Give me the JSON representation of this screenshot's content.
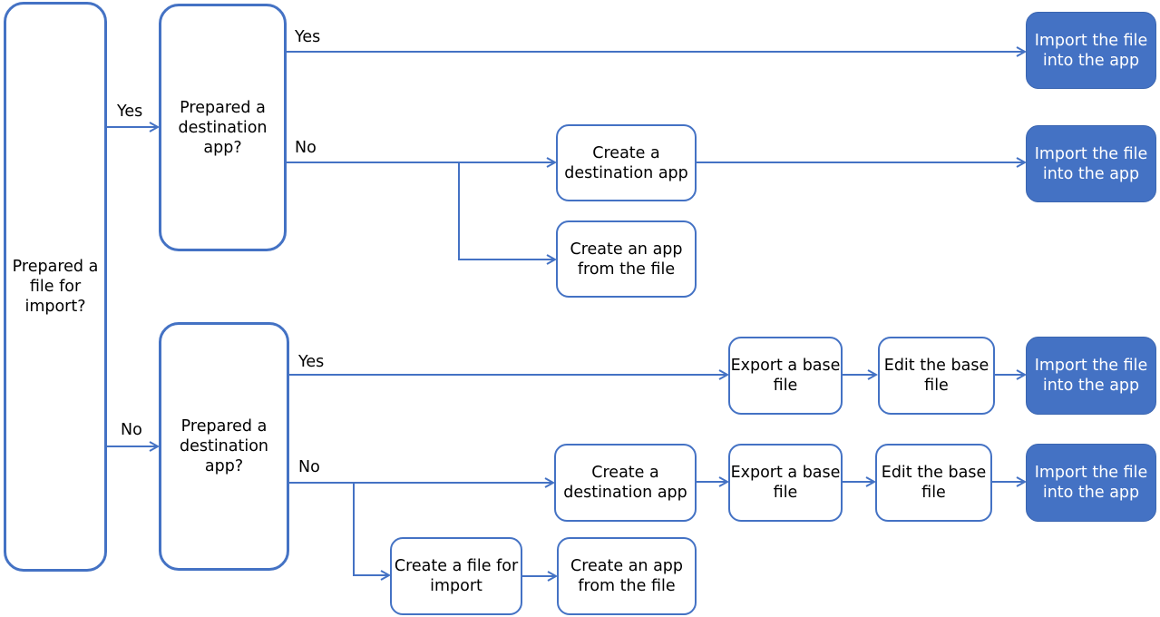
{
  "colors": {
    "accent": "#4472C4",
    "text": "#000000",
    "filled_text": "#FFFFFF"
  },
  "nodes": {
    "root": "Prepared a file for import?",
    "q_top": "Prepared a destination app?",
    "q_bottom": "Prepared a destination app?",
    "create_dest_top": "Create a destination app",
    "create_app_file_top": "Create an app from the file",
    "import_1": "Import the file into the app",
    "import_2": "Import the file into the app",
    "export_1": "Export a base file",
    "edit_1": "Edit the base file",
    "import_3": "Import the file into the app",
    "create_dest_bottom": "Create a destination app",
    "export_2": "Export a base file",
    "edit_2": "Edit the base file",
    "import_4": "Import the file into the app",
    "create_file": "Create a file for import",
    "create_app_file_bottom": "Create an app from the file"
  },
  "labels": {
    "root_yes": "Yes",
    "root_no": "No",
    "top_yes": "Yes",
    "top_no": "No",
    "bottom_yes": "Yes",
    "bottom_no": "No"
  }
}
